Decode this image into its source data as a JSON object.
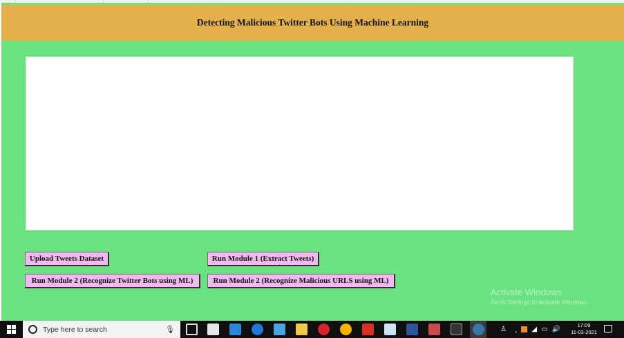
{
  "app": {
    "title": "Detecting Malicious Twitter Bots Using Machine Learning",
    "colors": {
      "background": "#6ae27f",
      "header": "#e3b04b",
      "button": "#f2b9f0"
    }
  },
  "buttons": {
    "upload": "Upload Tweets Dataset",
    "module1": "Run Module 1 (Extract Tweets)",
    "module2_bots": "Run Module 2 (Recognize Twitter Bots using ML)",
    "module2_urls": "Run Module 2 (Recognize Malicious URLS using ML)"
  },
  "output_text": "",
  "watermark": {
    "line1": "Activate Windows",
    "line2": "Go to Settings to activate Windows."
  },
  "taskbar": {
    "search_placeholder": "Type here to search",
    "time": "17:09",
    "date": "11-03-2021",
    "icons": [
      "task-view-icon",
      "store-icon",
      "mail-icon",
      "edge-icon",
      "photos-icon",
      "file-explorer-icon",
      "opera-icon",
      "chrome-icon",
      "acrobat-icon",
      "notepad-icon",
      "word-icon",
      "paint-icon",
      "terminal-icon",
      "python-icon"
    ]
  }
}
